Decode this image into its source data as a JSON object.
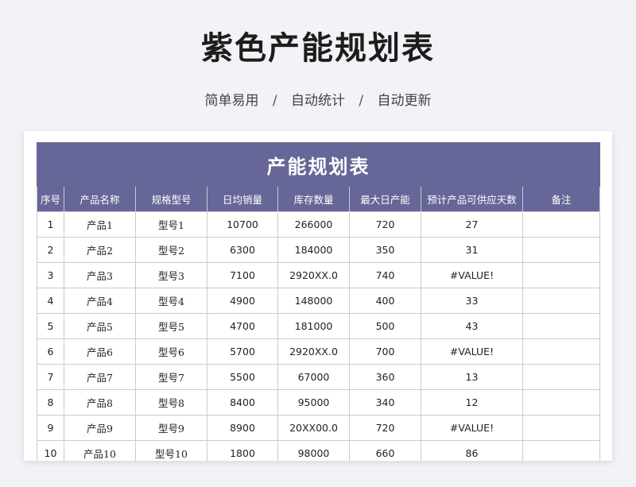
{
  "page": {
    "title": "紫色产能规划表",
    "subtitle_parts": [
      "简单易用",
      "自动统计",
      "自动更新"
    ],
    "separator": "/"
  },
  "sheet": {
    "banner": "产能规划表",
    "headers": [
      "序号",
      "产品名称",
      "规格型号",
      "日均销量",
      "库存数量",
      "最大日产能",
      "预计产品可供应天数",
      "备注"
    ],
    "rows": [
      [
        "1",
        "产品1",
        "型号1",
        "10700",
        "266000",
        "720",
        "27",
        ""
      ],
      [
        "2",
        "产品2",
        "型号2",
        "6300",
        "184000",
        "350",
        "31",
        ""
      ],
      [
        "3",
        "产品3",
        "型号3",
        "7100",
        "2920XX.0",
        "740",
        "#VALUE!",
        ""
      ],
      [
        "4",
        "产品4",
        "型号4",
        "4900",
        "148000",
        "400",
        "33",
        ""
      ],
      [
        "5",
        "产品5",
        "型号5",
        "4700",
        "181000",
        "500",
        "43",
        ""
      ],
      [
        "6",
        "产品6",
        "型号6",
        "5700",
        "2920XX.0",
        "700",
        "#VALUE!",
        ""
      ],
      [
        "7",
        "产品7",
        "型号7",
        "5500",
        "67000",
        "360",
        "13",
        ""
      ],
      [
        "8",
        "产品8",
        "型号8",
        "8400",
        "95000",
        "340",
        "12",
        ""
      ],
      [
        "9",
        "产品9",
        "型号9",
        "8900",
        "20XX00.0",
        "720",
        "#VALUE!",
        ""
      ],
      [
        "10",
        "产品10",
        "型号10",
        "1800",
        "98000",
        "660",
        "86",
        ""
      ]
    ],
    "colors": {
      "header": "#666698",
      "grid": "#c9c9d9"
    }
  }
}
